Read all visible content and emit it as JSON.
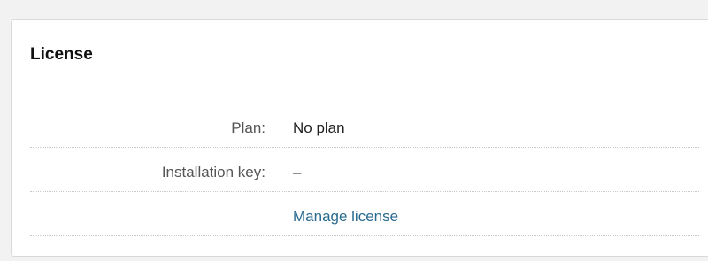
{
  "panel": {
    "title": "License"
  },
  "rows": [
    {
      "label": "Plan:",
      "value": "No plan"
    },
    {
      "label": "Installation key:",
      "value": "–"
    }
  ],
  "manage_link": {
    "label": "Manage license"
  },
  "colors": {
    "background": "#f2f2f2",
    "panel": "#ffffff",
    "link": "#2b6b8f",
    "label": "#555555"
  }
}
